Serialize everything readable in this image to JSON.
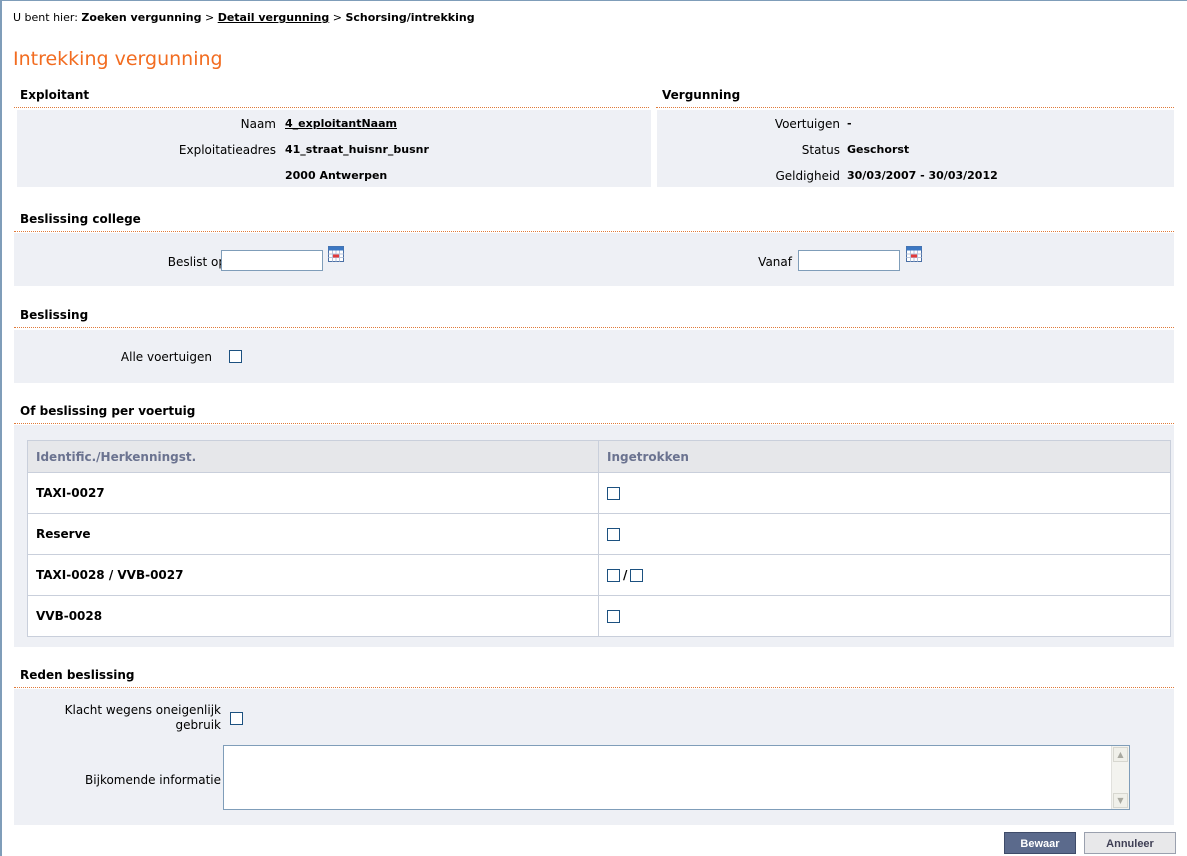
{
  "breadcrumb": {
    "prefix": "U bent hier:",
    "crumb1": "Zoeken vergunning",
    "sep1": ">",
    "crumb2": "Detail vergunning",
    "sep2": ">",
    "crumb3": "Schorsing/intrekking"
  },
  "title": "Intrekking vergunning",
  "exploitant": {
    "heading": "Exploitant",
    "naam_label": "Naam",
    "naam_value": "4_exploitantNaam",
    "adres_label": "Exploitatieadres",
    "adres_value": "41_straat_huisnr_busnr",
    "postcode_value": "2000 Antwerpen"
  },
  "vergunning": {
    "heading": "Vergunning",
    "voertuigen_label": "Voertuigen",
    "voertuigen_value": "-",
    "status_label": "Status",
    "status_value": "Geschorst",
    "geldigheid_label": "Geldigheid",
    "geldigheid_value": "30/03/2007 - 30/03/2012"
  },
  "college": {
    "heading": "Beslissing college",
    "beslist_label": "Beslist op",
    "beslist_value": "",
    "vanaf_label": "Vanaf",
    "vanaf_value": ""
  },
  "beslissing": {
    "heading": "Beslissing",
    "alle_label": "Alle voertuigen"
  },
  "per_voertuig": {
    "heading": "Of beslissing per voertuig",
    "col1": "Identific./Herkenningst.",
    "col2": "Ingetrokken",
    "rows": [
      {
        "id": "TAXI-0027"
      },
      {
        "id": "Reserve"
      },
      {
        "id": "TAXI-0028 / VVB-0027",
        "slash": "/"
      },
      {
        "id": "VVB-0028"
      }
    ]
  },
  "reden": {
    "heading": "Reden beslissing",
    "klacht_label_line1": "Klacht wegens oneigenlijk",
    "klacht_label_line2": "gebruik",
    "info_label": "Bijkomende informatie",
    "info_value": ""
  },
  "buttons": {
    "save": "Bewaar",
    "cancel": "Annuleer"
  },
  "colors": {
    "title": "#f26c20",
    "panel": "#eef0f5",
    "primary_button": "#5b6a8c"
  }
}
